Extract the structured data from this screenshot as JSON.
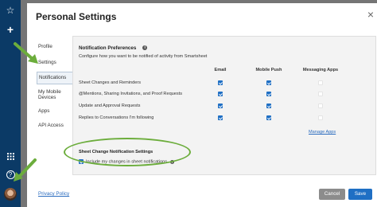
{
  "modal": {
    "title": "Personal Settings",
    "close": "×"
  },
  "nav": {
    "items": [
      {
        "label": "Profile"
      },
      {
        "label": "Settings"
      },
      {
        "label": "Notifications"
      },
      {
        "label": "My Mobile Devices"
      },
      {
        "label": "Apps"
      },
      {
        "label": "API Access"
      }
    ],
    "active": "Notifications"
  },
  "preferences": {
    "title": "Notification Preferences",
    "description": "Configure how you want to be notified of activity from Smartsheet",
    "columns": [
      "Email",
      "Mobile Push",
      "Messaging Apps"
    ],
    "rows": [
      {
        "label": "Sheet Changes and Reminders",
        "email": true,
        "push": true,
        "messaging": false
      },
      {
        "label": "@Mentions, Sharing Invitations, and Proof Requests",
        "email": true,
        "push": true,
        "messaging": false
      },
      {
        "label": "Update and Approval Requests",
        "email": true,
        "push": true,
        "messaging": false
      },
      {
        "label": "Replies to Conversations I'm following",
        "email": true,
        "push": true,
        "messaging": false
      }
    ],
    "manage_apps": "Manage Apps"
  },
  "sheet_change": {
    "title": "Sheet Change Notification Settings",
    "include_label": "Include my changes in sheet notifications",
    "include_checked": true
  },
  "footer": {
    "privacy": "Privacy Policy",
    "cancel": "Cancel",
    "save": "Save"
  },
  "colors": {
    "accent": "#1f6fc4",
    "rail": "#0b3a66",
    "annotation": "#6cad3c"
  },
  "icons": [
    "star-icon",
    "plus-icon",
    "grid-icon",
    "help-icon",
    "info-icon",
    "close-icon"
  ]
}
